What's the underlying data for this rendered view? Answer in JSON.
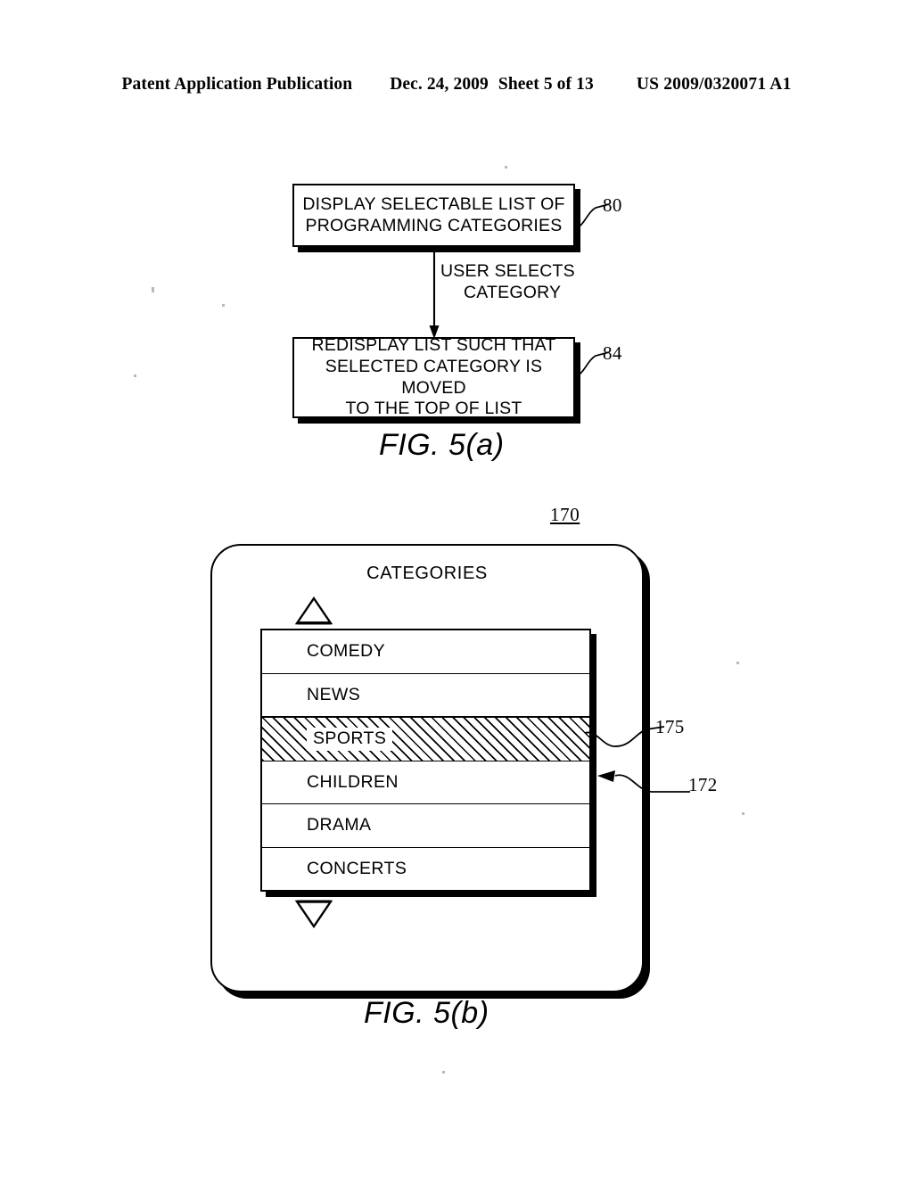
{
  "header": {
    "publication": "Patent Application Publication",
    "date": "Dec. 24, 2009",
    "sheet": "Sheet 5 of 13",
    "patent_number": "US 2009/0320071 A1"
  },
  "fig5a": {
    "caption": "FIG. 5(a)",
    "box_80": {
      "line1": "DISPLAY SELECTABLE LIST OF",
      "line2": "PROGRAMMING CATEGORIES",
      "ref": "80"
    },
    "box_84": {
      "line1": "REDISPLAY LIST SUCH THAT",
      "line2": "SELECTED CATEGORY IS MOVED",
      "line3": "TO THE TOP OF LIST",
      "ref": "84"
    },
    "arrow_label": {
      "line1": "USER SELECTS",
      "line2": "CATEGORY"
    }
  },
  "fig5b": {
    "caption": "FIG. 5(b)",
    "screen_ref": "170",
    "list_ref": "172",
    "highlight_ref": "175",
    "screen_title": "CATEGORIES",
    "scroll_up_icon": "triangle-up-icon",
    "scroll_down_icon": "triangle-down-icon",
    "categories": [
      {
        "label": "COMEDY",
        "selected": false
      },
      {
        "label": "NEWS",
        "selected": false
      },
      {
        "label": "SPORTS",
        "selected": true
      },
      {
        "label": "CHILDREN",
        "selected": false
      },
      {
        "label": "DRAMA",
        "selected": false
      },
      {
        "label": "CONCERTS",
        "selected": false
      }
    ]
  },
  "colors": {
    "ink": "#000000",
    "paper": "#ffffff"
  }
}
